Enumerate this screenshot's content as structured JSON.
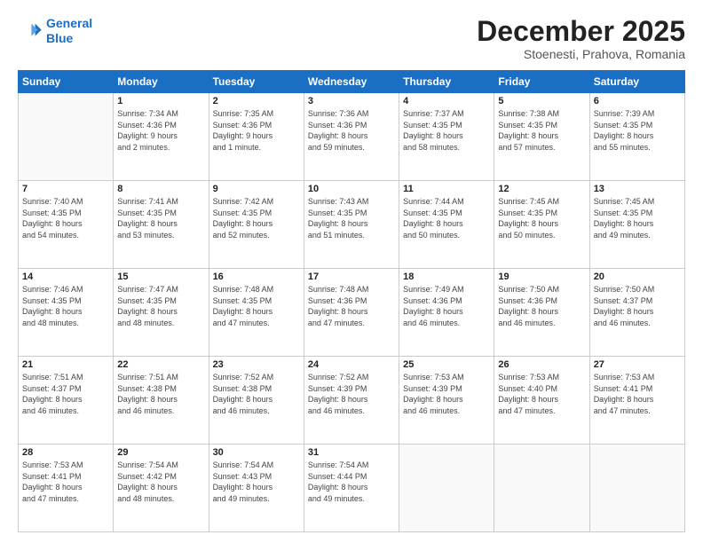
{
  "header": {
    "logo_line1": "General",
    "logo_line2": "Blue",
    "month": "December 2025",
    "location": "Stoenesti, Prahova, Romania"
  },
  "weekdays": [
    "Sunday",
    "Monday",
    "Tuesday",
    "Wednesday",
    "Thursday",
    "Friday",
    "Saturday"
  ],
  "weeks": [
    [
      {
        "day": "",
        "info": ""
      },
      {
        "day": "1",
        "info": "Sunrise: 7:34 AM\nSunset: 4:36 PM\nDaylight: 9 hours\nand 2 minutes."
      },
      {
        "day": "2",
        "info": "Sunrise: 7:35 AM\nSunset: 4:36 PM\nDaylight: 9 hours\nand 1 minute."
      },
      {
        "day": "3",
        "info": "Sunrise: 7:36 AM\nSunset: 4:36 PM\nDaylight: 8 hours\nand 59 minutes."
      },
      {
        "day": "4",
        "info": "Sunrise: 7:37 AM\nSunset: 4:35 PM\nDaylight: 8 hours\nand 58 minutes."
      },
      {
        "day": "5",
        "info": "Sunrise: 7:38 AM\nSunset: 4:35 PM\nDaylight: 8 hours\nand 57 minutes."
      },
      {
        "day": "6",
        "info": "Sunrise: 7:39 AM\nSunset: 4:35 PM\nDaylight: 8 hours\nand 55 minutes."
      }
    ],
    [
      {
        "day": "7",
        "info": "Sunrise: 7:40 AM\nSunset: 4:35 PM\nDaylight: 8 hours\nand 54 minutes."
      },
      {
        "day": "8",
        "info": "Sunrise: 7:41 AM\nSunset: 4:35 PM\nDaylight: 8 hours\nand 53 minutes."
      },
      {
        "day": "9",
        "info": "Sunrise: 7:42 AM\nSunset: 4:35 PM\nDaylight: 8 hours\nand 52 minutes."
      },
      {
        "day": "10",
        "info": "Sunrise: 7:43 AM\nSunset: 4:35 PM\nDaylight: 8 hours\nand 51 minutes."
      },
      {
        "day": "11",
        "info": "Sunrise: 7:44 AM\nSunset: 4:35 PM\nDaylight: 8 hours\nand 50 minutes."
      },
      {
        "day": "12",
        "info": "Sunrise: 7:45 AM\nSunset: 4:35 PM\nDaylight: 8 hours\nand 50 minutes."
      },
      {
        "day": "13",
        "info": "Sunrise: 7:45 AM\nSunset: 4:35 PM\nDaylight: 8 hours\nand 49 minutes."
      }
    ],
    [
      {
        "day": "14",
        "info": "Sunrise: 7:46 AM\nSunset: 4:35 PM\nDaylight: 8 hours\nand 48 minutes."
      },
      {
        "day": "15",
        "info": "Sunrise: 7:47 AM\nSunset: 4:35 PM\nDaylight: 8 hours\nand 48 minutes."
      },
      {
        "day": "16",
        "info": "Sunrise: 7:48 AM\nSunset: 4:35 PM\nDaylight: 8 hours\nand 47 minutes."
      },
      {
        "day": "17",
        "info": "Sunrise: 7:48 AM\nSunset: 4:36 PM\nDaylight: 8 hours\nand 47 minutes."
      },
      {
        "day": "18",
        "info": "Sunrise: 7:49 AM\nSunset: 4:36 PM\nDaylight: 8 hours\nand 46 minutes."
      },
      {
        "day": "19",
        "info": "Sunrise: 7:50 AM\nSunset: 4:36 PM\nDaylight: 8 hours\nand 46 minutes."
      },
      {
        "day": "20",
        "info": "Sunrise: 7:50 AM\nSunset: 4:37 PM\nDaylight: 8 hours\nand 46 minutes."
      }
    ],
    [
      {
        "day": "21",
        "info": "Sunrise: 7:51 AM\nSunset: 4:37 PM\nDaylight: 8 hours\nand 46 minutes."
      },
      {
        "day": "22",
        "info": "Sunrise: 7:51 AM\nSunset: 4:38 PM\nDaylight: 8 hours\nand 46 minutes."
      },
      {
        "day": "23",
        "info": "Sunrise: 7:52 AM\nSunset: 4:38 PM\nDaylight: 8 hours\nand 46 minutes."
      },
      {
        "day": "24",
        "info": "Sunrise: 7:52 AM\nSunset: 4:39 PM\nDaylight: 8 hours\nand 46 minutes."
      },
      {
        "day": "25",
        "info": "Sunrise: 7:53 AM\nSunset: 4:39 PM\nDaylight: 8 hours\nand 46 minutes."
      },
      {
        "day": "26",
        "info": "Sunrise: 7:53 AM\nSunset: 4:40 PM\nDaylight: 8 hours\nand 47 minutes."
      },
      {
        "day": "27",
        "info": "Sunrise: 7:53 AM\nSunset: 4:41 PM\nDaylight: 8 hours\nand 47 minutes."
      }
    ],
    [
      {
        "day": "28",
        "info": "Sunrise: 7:53 AM\nSunset: 4:41 PM\nDaylight: 8 hours\nand 47 minutes."
      },
      {
        "day": "29",
        "info": "Sunrise: 7:54 AM\nSunset: 4:42 PM\nDaylight: 8 hours\nand 48 minutes."
      },
      {
        "day": "30",
        "info": "Sunrise: 7:54 AM\nSunset: 4:43 PM\nDaylight: 8 hours\nand 49 minutes."
      },
      {
        "day": "31",
        "info": "Sunrise: 7:54 AM\nSunset: 4:44 PM\nDaylight: 8 hours\nand 49 minutes."
      },
      {
        "day": "",
        "info": ""
      },
      {
        "day": "",
        "info": ""
      },
      {
        "day": "",
        "info": ""
      }
    ]
  ]
}
